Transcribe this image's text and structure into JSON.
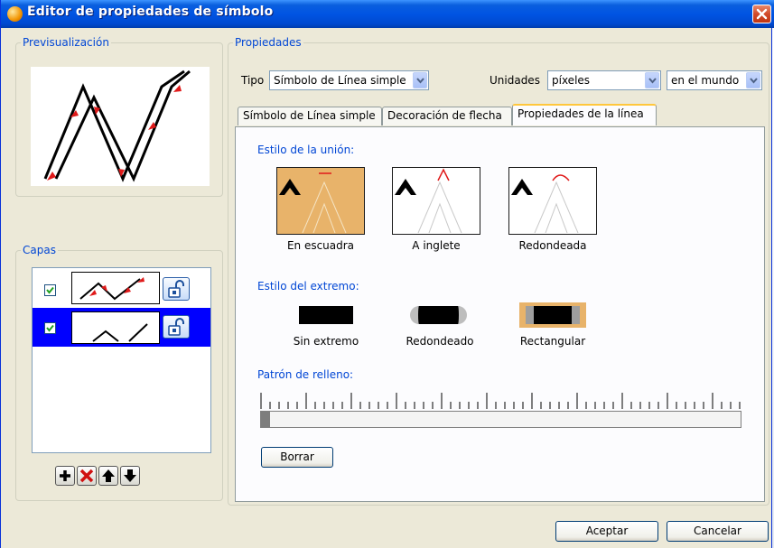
{
  "window": {
    "title": "Editor de propiedades de símbolo"
  },
  "preview": {
    "group_title": "Previsualización"
  },
  "layers": {
    "group_title": "Capas",
    "rows": [
      {
        "checked": true,
        "selected": false
      },
      {
        "checked": true,
        "selected": true
      }
    ],
    "buttons": [
      "plus-icon",
      "delete-x-icon",
      "arrow-up-icon",
      "arrow-down-icon"
    ]
  },
  "properties": {
    "group_title": "Propiedades",
    "type_label": "Tipo",
    "type_value": "Símbolo de Línea simple",
    "units_label": "Unidades",
    "units_value": "píxeles",
    "scope_value": "en el mundo"
  },
  "tabs": [
    {
      "label": "Símbolo de Línea simple",
      "active": false
    },
    {
      "label": "Decoración de flecha",
      "active": false
    },
    {
      "label": "Propiedades de la línea",
      "active": true
    }
  ],
  "join": {
    "title": "Estilo de la unión:",
    "options": [
      {
        "label": "En escuadra",
        "selected": true
      },
      {
        "label": "A inglete",
        "selected": false
      },
      {
        "label": "Redondeada",
        "selected": false
      }
    ]
  },
  "cap": {
    "title": "Estilo del extremo:",
    "options": [
      {
        "label": "Sin extremo",
        "selected": false
      },
      {
        "label": "Redondeado",
        "selected": false
      },
      {
        "label": "Rectangular",
        "selected": true
      }
    ]
  },
  "pattern": {
    "title": "Patrón de relleno:",
    "clear_label": "Borrar"
  },
  "footer": {
    "ok_label": "Aceptar",
    "cancel_label": "Cancelar"
  },
  "colors": {
    "title_bar": "#0054e3",
    "dialog_bg": "#ece9d8",
    "selection": "#0000ff",
    "selected_option": "#e8b36a",
    "label_blue": "#0046d5"
  }
}
